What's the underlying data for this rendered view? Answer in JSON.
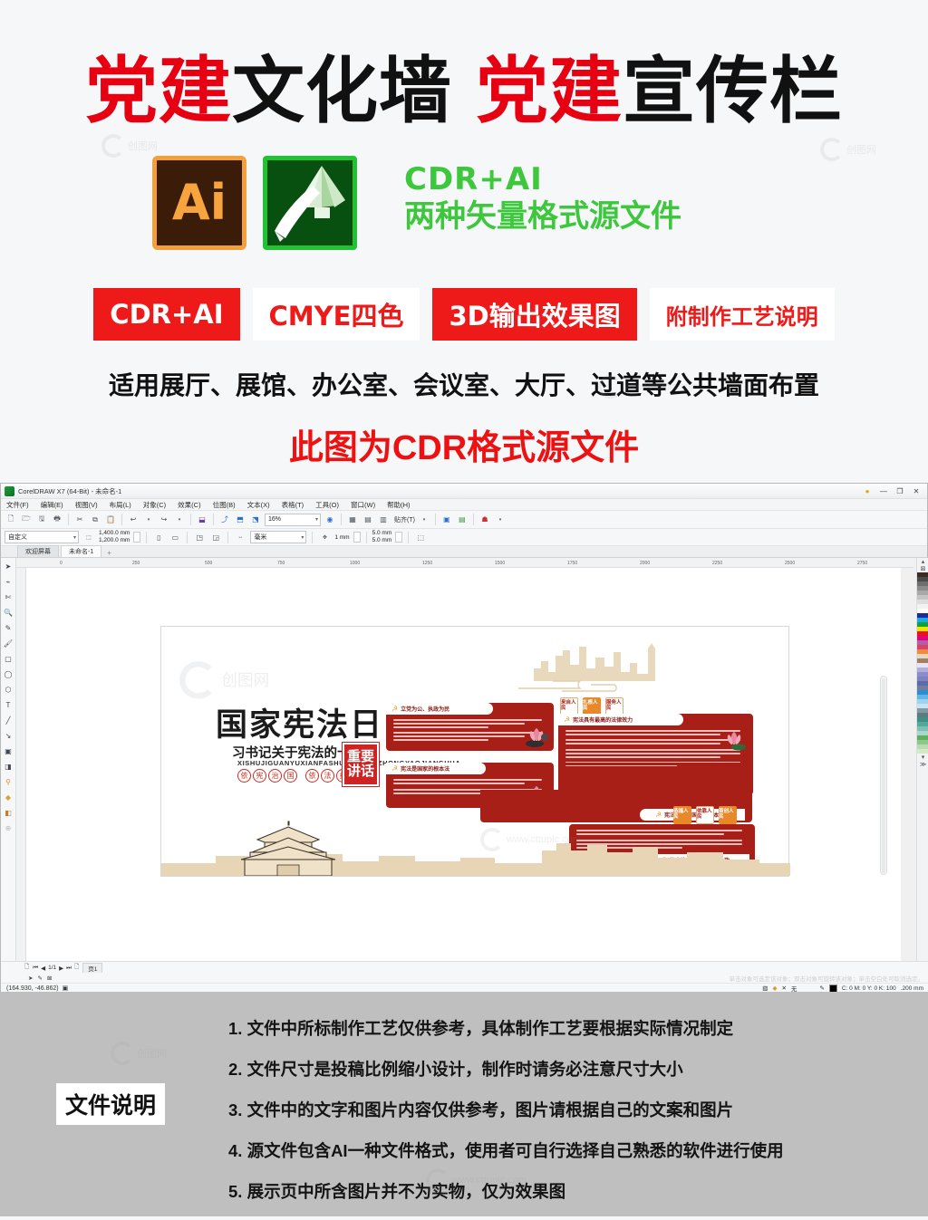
{
  "promo": {
    "title_parts": [
      {
        "text": "党建",
        "color": "red"
      },
      {
        "text": "文化墙",
        "color": "black"
      },
      {
        "text": "党建",
        "color": "red"
      },
      {
        "text": "宣传栏",
        "color": "black"
      }
    ],
    "ai_icon_label": "Ai",
    "format_line1": "CDR+AI",
    "format_line2": "两种矢量格式源文件",
    "badges": [
      {
        "label": "CDR+AI",
        "style": "solid"
      },
      {
        "label": "CMYE四色",
        "style": "ghost"
      },
      {
        "label": "3D输出效果图",
        "style": "solid"
      },
      {
        "label": "附制作工艺说明",
        "style": "ghost"
      }
    ],
    "usage_line": "适用展厅、展馆、办公室、会议室、大厅、过道等公共墙面布置",
    "slogan": "此图为CDR格式源文件",
    "watermark_text": "创图网",
    "watermark_url": "www.cttupic.com",
    "colors": {
      "red": "#e60012",
      "badge_red": "#ee1a1a",
      "green": "#3cc73c",
      "ai_orange": "#f7a33e",
      "cdr_green": "#23c234"
    }
  },
  "app": {
    "window_title": "CorelDRAW X7 (64-Bit) - 未命名-1",
    "window_buttons": [
      "—",
      "❐",
      "✕"
    ],
    "menu": [
      "文件(F)",
      "编辑(E)",
      "视图(V)",
      "布局(L)",
      "对象(C)",
      "效果(C)",
      "位图(B)",
      "文本(X)",
      "表格(T)",
      "工具(O)",
      "窗口(W)",
      "帮助(H)"
    ],
    "toolbar": {
      "zoom_level": "16%",
      "snap_label": "贴齐(T)",
      "icons": [
        "new-file-icon",
        "open-file-icon",
        "save-icon",
        "print-icon",
        "cut-icon",
        "copy-icon",
        "paste-icon",
        "undo-icon",
        "redo-icon",
        "import-icon",
        "export-icon",
        "publish-pdf-icon",
        "launch-icon",
        "zoom-dropdown",
        "fullscreen-icon",
        "show-grid-icon",
        "show-guides-icon",
        "snap-icon",
        "options-icon",
        "app-launcher-icon",
        "help-icon"
      ]
    },
    "property_bar": {
      "page_preset": "自定义",
      "page_width": "1,400.0 mm",
      "page_height": "1,200.0 mm",
      "orientation_portrait": "portrait-icon",
      "orientation_landscape": "landscape-icon",
      "units": "毫米",
      "nudge": "1 mm",
      "duplicate_x": "5.0 mm",
      "duplicate_y": "5.0 mm"
    },
    "tabs": [
      {
        "label": "欢迎屏幕",
        "active": false
      },
      {
        "label": "未命名-1",
        "active": true
      }
    ],
    "tab_add": "+",
    "toolbox": [
      "pick-tool",
      "shape-tool",
      "crop-tool",
      "zoom-tool",
      "freehand-tool",
      "artistic-media-tool",
      "rectangle-tool",
      "ellipse-tool",
      "polygon-tool",
      "text-tool",
      "parallel-dimension-tool",
      "straight-line-connector-tool",
      "drop-shadow-tool",
      "transparency-tool",
      "color-eyedropper-tool",
      "interactive-fill-tool",
      "smart-fill-tool",
      "add-anchor-tool"
    ],
    "ruler_ticks": [
      "0",
      "250",
      "500",
      "750",
      "1000",
      "1250",
      "1500",
      "1750",
      "2000",
      "2250",
      "2500",
      "2750"
    ],
    "status": {
      "page_current": "1/1",
      "page_tab": "页1",
      "coordinates": "(164.930, -46.862)",
      "hint": "单击对象可选定该对象；双击对象可旋转该对象；单击空白处可取消选定。",
      "fill_label": "无",
      "outline_color": "C: 0 M: 0 Y: 0 K: 100",
      "outline_width": ".200 mm"
    }
  },
  "artwork": {
    "main_title": "国家宪法日",
    "subtitle": "习书记关于宪法的十句",
    "pinyin": "XISHUJIGUANYUXIANFASHUDESHIJUZHONGYAOJIANGHUA",
    "stamp": [
      "重要",
      "讲话"
    ],
    "seals": [
      "依",
      "宪",
      "治",
      "国",
      "依",
      "法",
      "执",
      "政"
    ],
    "panels": [
      {
        "title": "立党为公、执政为民",
        "position": "top-left"
      },
      {
        "title": "宪法具有最高的法律效力",
        "position": "top-right"
      },
      {
        "title": "宪法是国家的根本法",
        "position": "mid-left"
      },
      {
        "title": "宪法是党和国家的根本大法",
        "position": "mid-right"
      },
      {
        "title": "依宪治国首先是依宪执政",
        "position": "bottom-right"
      }
    ],
    "tag_groups": [
      {
        "tags": [
          {
            "label": "来自人民",
            "style": "w"
          },
          {
            "label": "扎根人民",
            "style": "o"
          },
          {
            "label": "服务人民",
            "style": "w"
          }
        ]
      },
      {
        "tags": [
          {
            "label": "造福人民",
            "style": "o"
          },
          {
            "label": "依靠人民",
            "style": "w"
          },
          {
            "label": "首创人民",
            "style": "o"
          }
        ]
      }
    ],
    "colors": {
      "panel_red": "#a81f17",
      "accent_gold": "#e0a93f",
      "skyline_beige": "#e8d5b5"
    }
  },
  "footer": {
    "label": "文件说明",
    "notes": [
      "1. 文件中所标制作工艺仅供参考，具体制作工艺要根据实际情况制定",
      "2. 文件尺寸是投稿比例缩小设计，制作时请务必注意尺寸大小",
      "3. 文件中的文字和图片内容仅供参考，图片请根据自己的文案和图片",
      "4. 源文件包含AI一种文件格式，使用者可自行选择自己熟悉的软件进行使用",
      "5. 展示页中所含图片并不为实物，仅为效果图"
    ]
  }
}
